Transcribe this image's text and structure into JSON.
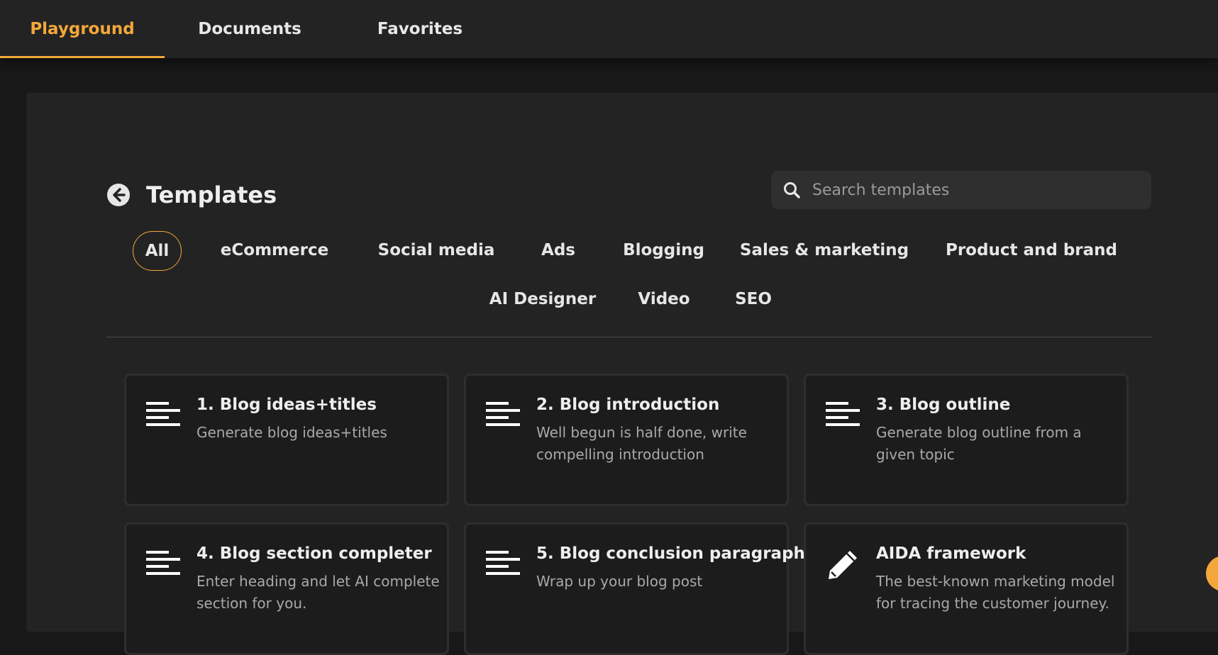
{
  "tabs": [
    {
      "label": "Playground",
      "active": true
    },
    {
      "label": "Documents",
      "active": false
    },
    {
      "label": "Favorites",
      "active": false
    }
  ],
  "header": {
    "title": "Templates",
    "back_icon": "arrow-left-circle-icon"
  },
  "search": {
    "placeholder": "Search templates",
    "value": "",
    "icon": "search-icon"
  },
  "categories": [
    {
      "label": "All",
      "active": true
    },
    {
      "label": "eCommerce"
    },
    {
      "label": "Social media"
    },
    {
      "label": "Ads"
    },
    {
      "label": "Blogging"
    },
    {
      "label": "Sales & marketing"
    },
    {
      "label": "Product and brand"
    },
    {
      "label": "AI Designer"
    },
    {
      "label": "Video"
    },
    {
      "label": "SEO"
    }
  ],
  "cards": [
    {
      "title": "1. Blog ideas+titles",
      "desc": "Generate blog ideas+titles",
      "icon": "align-left-icon"
    },
    {
      "title": "2. Blog introduction",
      "desc": "Well begun is half done, write compelling introduction",
      "icon": "align-left-icon"
    },
    {
      "title": "3. Blog outline",
      "desc": "Generate blog outline from a given topic",
      "icon": "align-left-icon"
    },
    {
      "title": "4. Blog section completer",
      "desc": "Enter heading and let AI complete section for you.",
      "icon": "align-left-icon"
    },
    {
      "title": "5. Blog conclusion paragraph",
      "desc": "Wrap up your blog post",
      "icon": "align-left-icon"
    },
    {
      "title": "AIDA framework",
      "desc": "The best-known marketing model for tracing the customer journey.",
      "icon": "pencil-icon"
    }
  ],
  "colors": {
    "accent": "#f3a73a",
    "background": "#181818",
    "panel": "#232323",
    "card": "#1c1c1c"
  }
}
